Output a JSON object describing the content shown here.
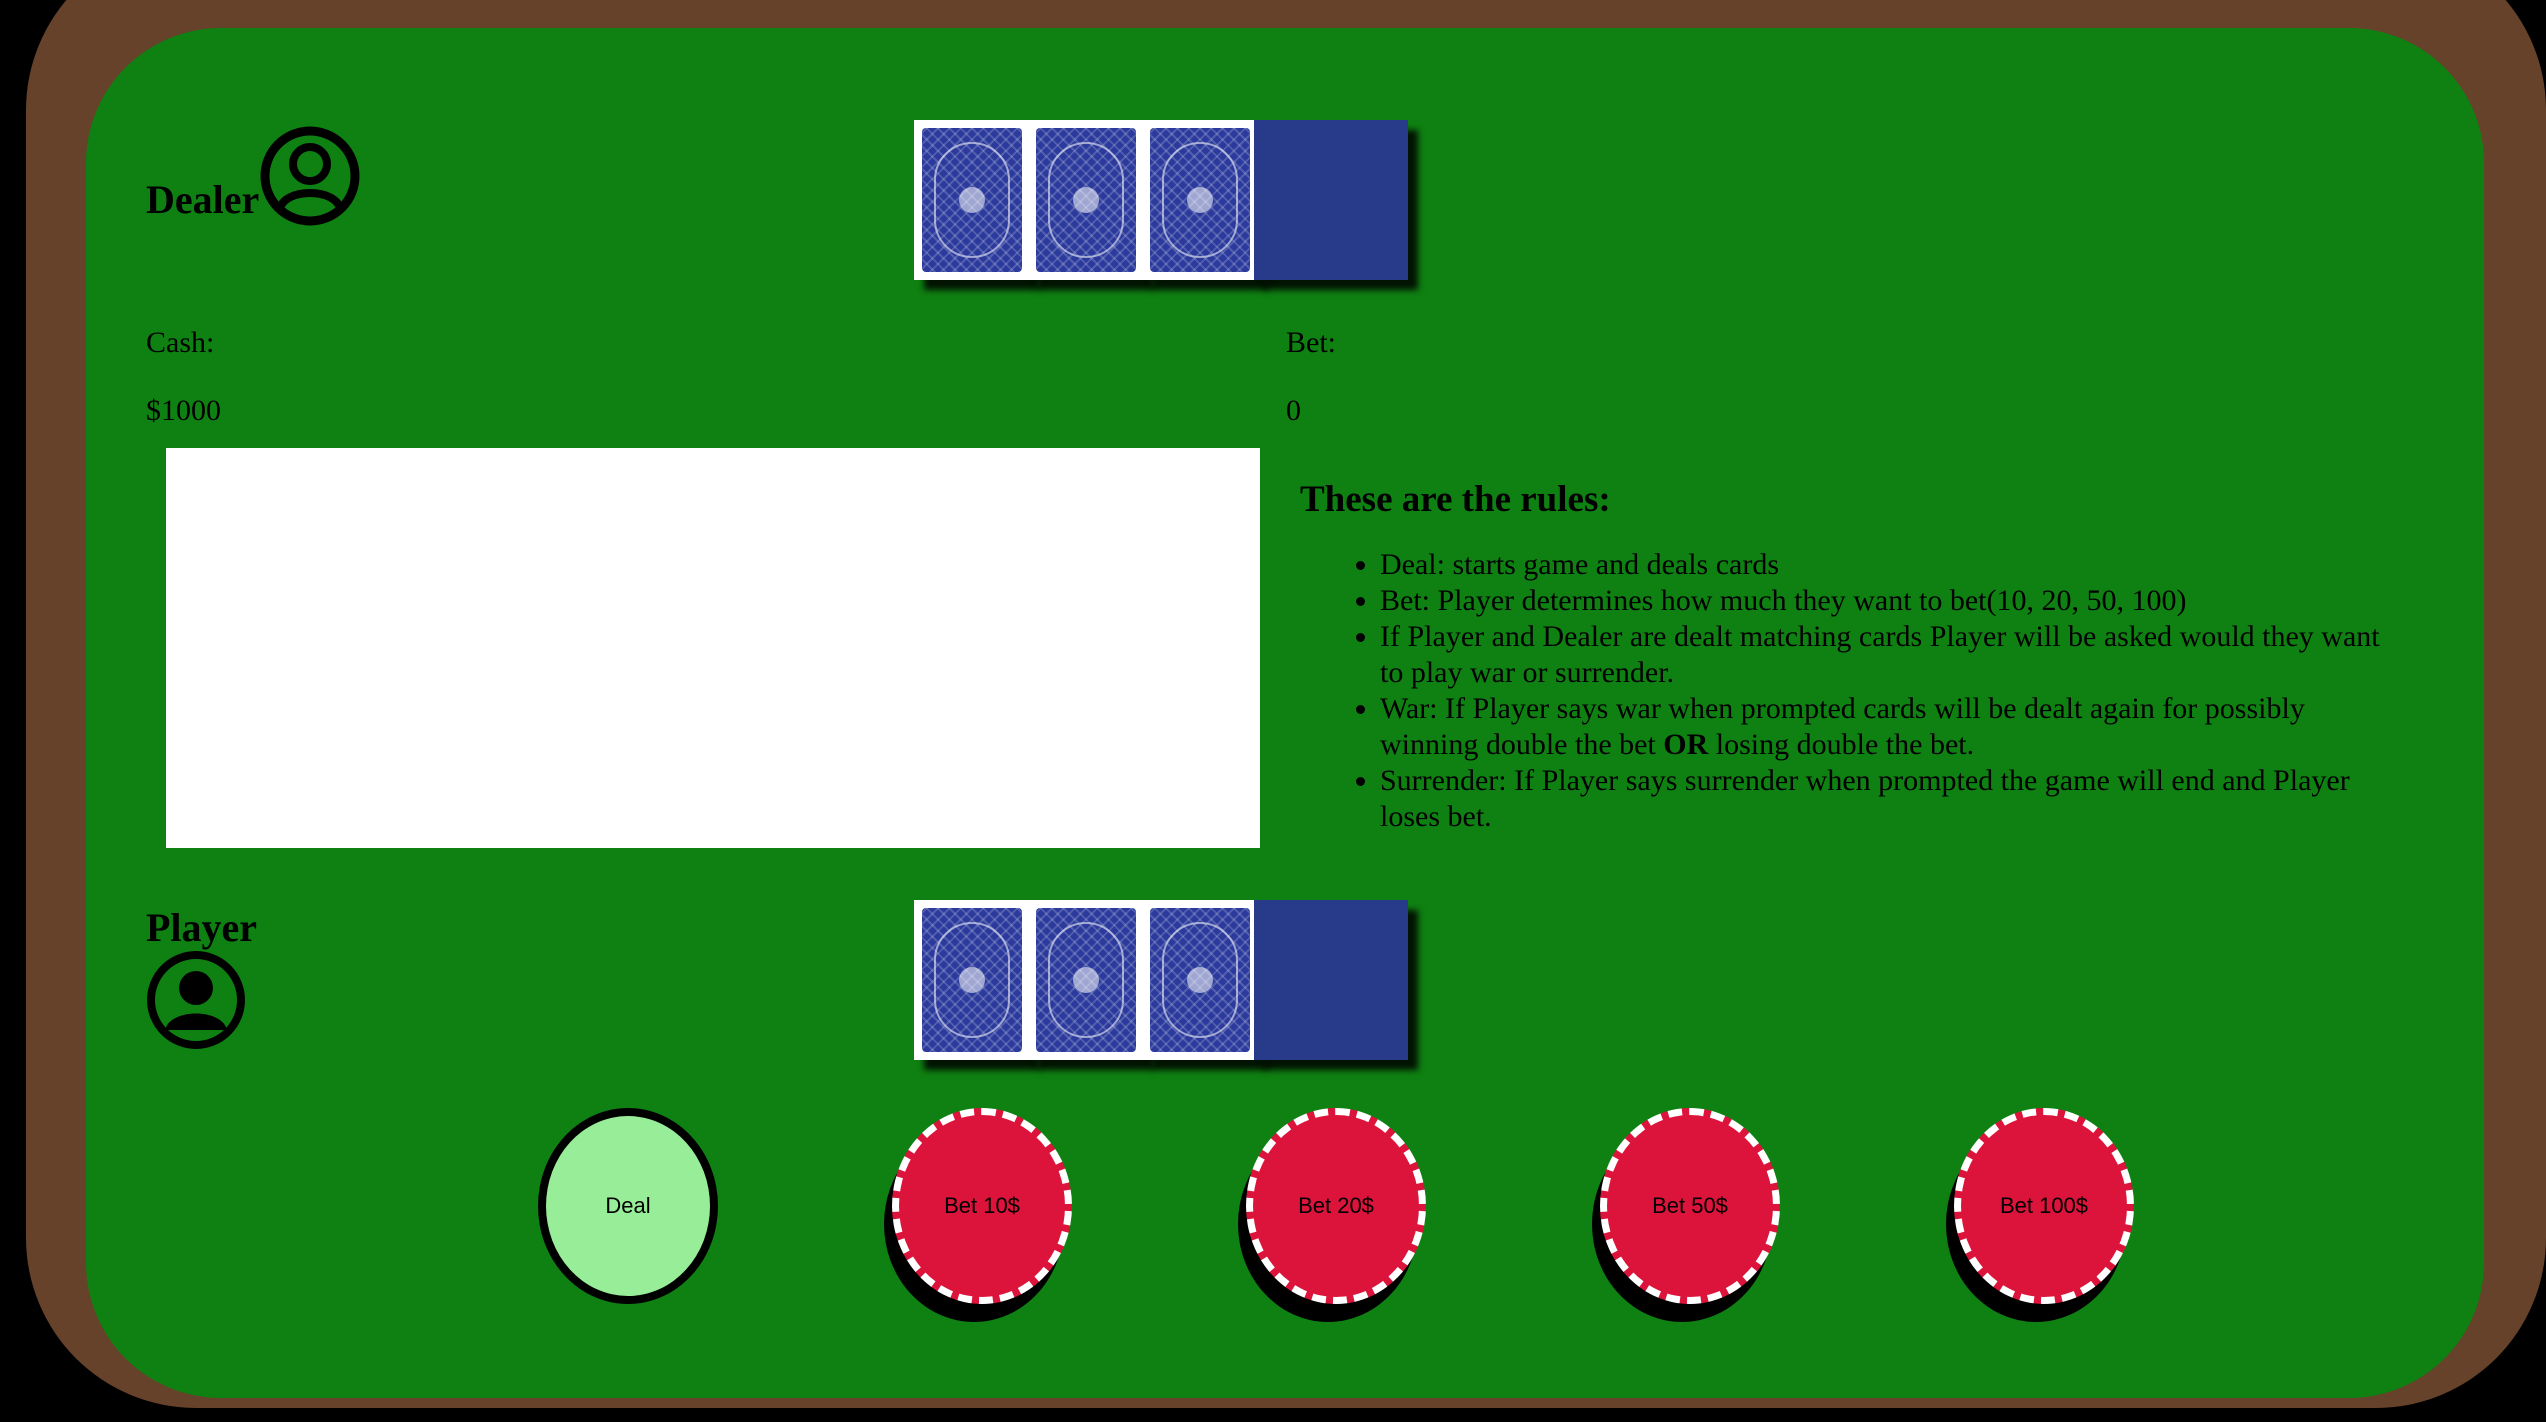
{
  "dealer": {
    "name": "Dealer",
    "avatar_icon": "user-circle-icon"
  },
  "player": {
    "name": "Player",
    "avatar_icon": "user-circle-icon"
  },
  "stats": {
    "cash_label": "Cash:",
    "cash_value": "$1000",
    "bet_label": "Bet:",
    "bet_value": "0"
  },
  "rules": {
    "heading": "These are the rules:",
    "items": [
      {
        "text": "Deal: starts game and deals cards"
      },
      {
        "text": "Bet: Player determines how much they want to bet(10, 20, 50, 100)"
      },
      {
        "text": "If Player and Dealer are dealt matching cards Player will be asked would they want to play war or surrender."
      },
      {
        "before": "War: If Player says war when prompted cards will be dealt again for possibly winning double the bet ",
        "strong": "OR",
        "after": " losing double the bet."
      },
      {
        "text": "Surrender: If Player says surrender when prompted the game will end and Player loses bet."
      }
    ]
  },
  "controls": {
    "deal_label": "Deal",
    "bet_10_label": "Bet 10$",
    "bet_20_label": "Bet 20$",
    "bet_50_label": "Bet 50$",
    "bet_100_label": "Bet 100$"
  },
  "colors": {
    "felt": "#0f8012",
    "rail": "#66422a",
    "card_back": "#2b3a9c",
    "card_face_down": "#283a8a",
    "deal_chip": "#98ee98",
    "bet_chip": "#dc143c"
  }
}
